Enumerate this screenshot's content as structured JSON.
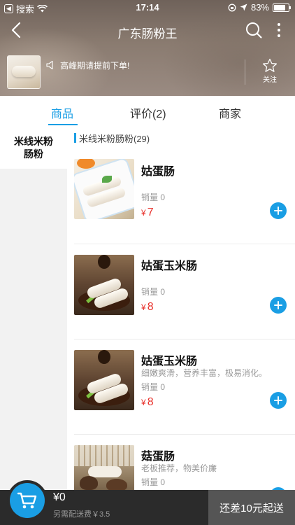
{
  "status_bar": {
    "carrier": "搜索",
    "time": "17:14",
    "battery": "83%"
  },
  "nav": {
    "title": "广东肠粉王"
  },
  "shop": {
    "notice": "高峰期请提前下单!",
    "favorite_label": "关注"
  },
  "tabs": [
    {
      "label": "商品",
      "active": true
    },
    {
      "label": "评价(2)",
      "active": false
    },
    {
      "label": "商家",
      "active": false
    }
  ],
  "categories": [
    {
      "label": "米线米粉肠粉",
      "active": true
    }
  ],
  "section": {
    "title": "米线米粉肠粉(29)"
  },
  "products": [
    {
      "name": "姑蛋肠",
      "desc": "",
      "sales": "销量 0",
      "currency": "¥",
      "price": "7"
    },
    {
      "name": "姑蛋玉米肠",
      "desc": "",
      "sales": "销量 0",
      "currency": "¥",
      "price": "8"
    },
    {
      "name": "姑蛋玉米肠",
      "desc": "细嫩爽滑，营养丰富，极易消化。",
      "sales": "销量 0",
      "currency": "¥",
      "price": "8"
    },
    {
      "name": "菇蛋肠",
      "desc": "老板推荐，物美价廉",
      "sales": "销量 0",
      "currency": "¥",
      "price": ""
    }
  ],
  "cart": {
    "total": "¥0",
    "delivery_fee": "另需配送费￥3.5",
    "checkout_label": "还差10元起送"
  },
  "colors": {
    "accent": "#1a9ee4",
    "price": "#e8312b",
    "cart_bar": "#2b2b2b"
  }
}
